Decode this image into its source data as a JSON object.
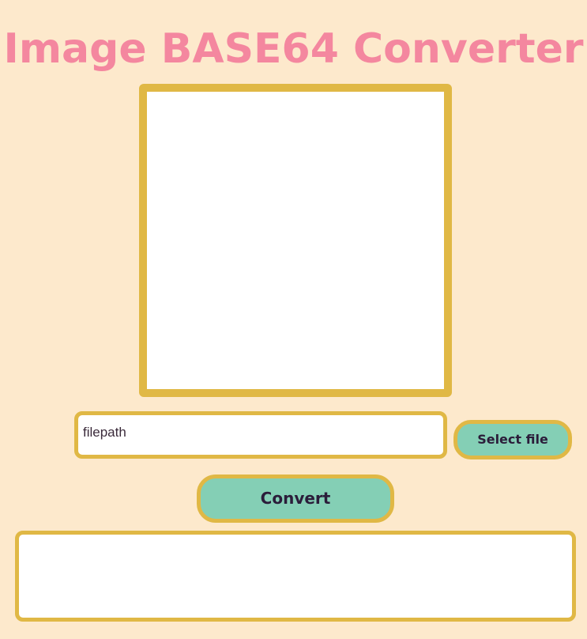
{
  "header": {
    "title": "Image BASE64 Converter"
  },
  "file_input": {
    "value": "filepath"
  },
  "buttons": {
    "select_file": "Select file",
    "convert": "Convert"
  },
  "colors": {
    "background": "#fde9cc",
    "title": "#f4879f",
    "border": "#e0b845",
    "button_fill": "#84cfb5",
    "button_text": "#2b1d3a"
  }
}
